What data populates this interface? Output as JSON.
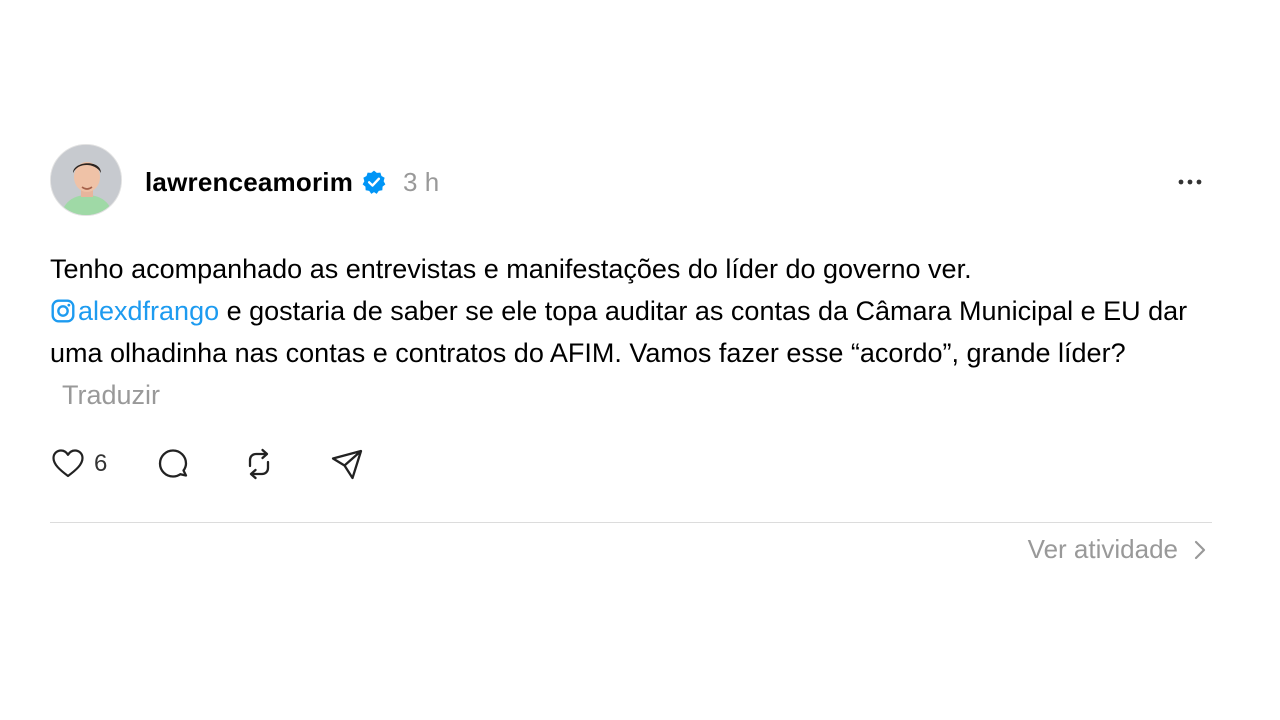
{
  "post": {
    "username": "lawrenceamorim",
    "verified": true,
    "time": "3 h",
    "text_before": "Tenho acompanhado as entrevistas e manifestações do líder do governo ver.",
    "mention": "alexdfrango",
    "text_after": " e gostaria de saber se ele topa auditar as contas da Câmara Municipal e EU dar uma olhadinha nas contas e contratos do AFIM. Vamos fazer esse “acordo”, grande líder?",
    "translate_label": "Traduzir",
    "like_count": "6",
    "activity_label": "Ver atividade"
  },
  "icons": {
    "verified": "verified-badge-icon",
    "more": "more-horizontal-icon",
    "mention": "instagram-icon",
    "like": "heart-icon",
    "comment": "comment-bubble-icon",
    "repost": "repost-icon",
    "share": "send-icon",
    "activity": "chevron-right-icon"
  },
  "colors": {
    "mention": "#1d9bf0",
    "muted": "#999999",
    "verified": "#0095f6",
    "divider": "#dcdcdc"
  }
}
